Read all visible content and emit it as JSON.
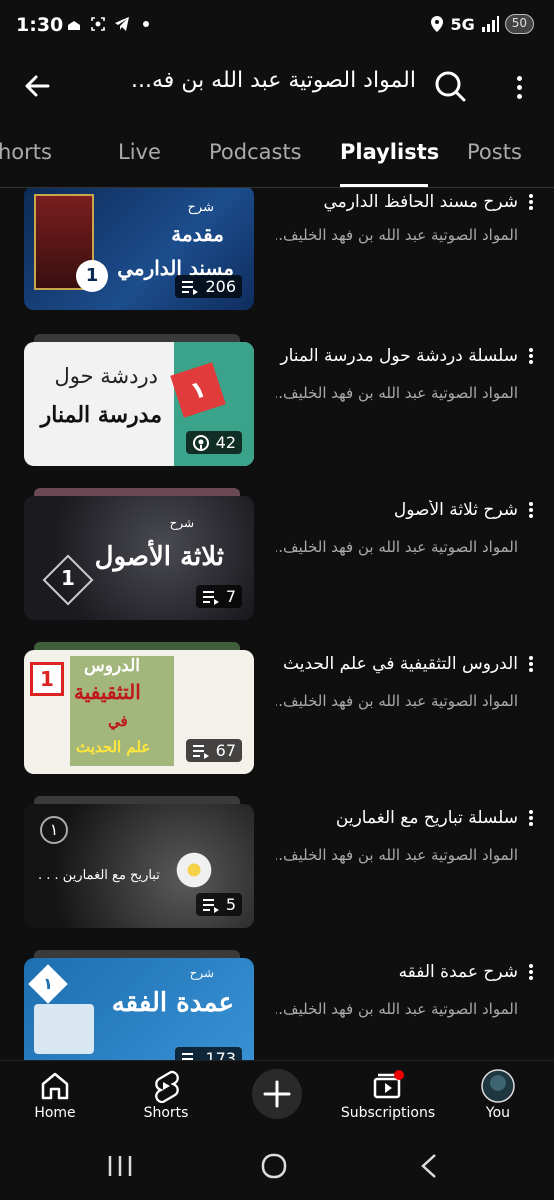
{
  "status_bar": {
    "time": "1:30",
    "network": "5G",
    "battery": "50"
  },
  "header": {
    "title": "المواد الصوتية عبد الله بن فه..."
  },
  "tabs": [
    {
      "label": "horts"
    },
    {
      "label": "Live"
    },
    {
      "label": "Podcasts"
    },
    {
      "label": "Playlists",
      "active": true
    },
    {
      "label": "Posts"
    }
  ],
  "playlists": [
    {
      "title": "شرح مسند الحافظ الدارمي",
      "channel": "المواد الصوتية عبد الله بن فهد الخليف...",
      "count": "206",
      "badge_icon": "playlist-icon",
      "thumb_lines": [
        "شرح",
        "مقدمة",
        "مسند الدارمي"
      ],
      "number": "1"
    },
    {
      "title": "سلسلة دردشة حول مدرسة المنار",
      "channel": "المواد الصوتية عبد الله بن فهد الخليف...",
      "count": "42",
      "badge_icon": "podcast-icon",
      "thumb_lines": [
        "دردشة حول",
        "مدرسة المنار"
      ],
      "number": "١"
    },
    {
      "title": "شرح ثلاثة الأصول",
      "channel": "المواد الصوتية عبد الله بن فهد الخليف...",
      "count": "7",
      "badge_icon": "playlist-icon",
      "thumb_lines": [
        "شرح",
        "ثلاثة الأصول"
      ],
      "number": "1"
    },
    {
      "title": "الدروس التثقيفية في علم الحديث",
      "channel": "المواد الصوتية عبد الله بن فهد الخليف...",
      "count": "67",
      "badge_icon": "playlist-icon",
      "thumb_lines": [
        "الدروس",
        "التثقيفية",
        "في",
        "علم الحديث"
      ],
      "number": "1"
    },
    {
      "title": "سلسلة تباريح مع الغمارين",
      "channel": "المواد الصوتية عبد الله بن فهد الخليف...",
      "count": "5",
      "badge_icon": "playlist-icon",
      "thumb_lines": [
        "تباريح مع الغمارين . . ."
      ],
      "number": "١"
    },
    {
      "title": "شرح عمدة الفقه",
      "channel": "المواد الصوتية عبد الله بن فهد الخليف...",
      "count": "173",
      "badge_icon": "playlist-icon",
      "thumb_lines": [
        "شرح",
        "عمدة الفقه"
      ],
      "number": "١"
    }
  ],
  "bottom_nav": [
    {
      "label": "Home",
      "icon": "home-icon"
    },
    {
      "label": "Shorts",
      "icon": "shorts-icon"
    },
    {
      "label": "",
      "icon": "create-icon"
    },
    {
      "label": "Subscriptions",
      "icon": "subscriptions-icon"
    },
    {
      "label": "You",
      "icon": "avatar"
    }
  ]
}
